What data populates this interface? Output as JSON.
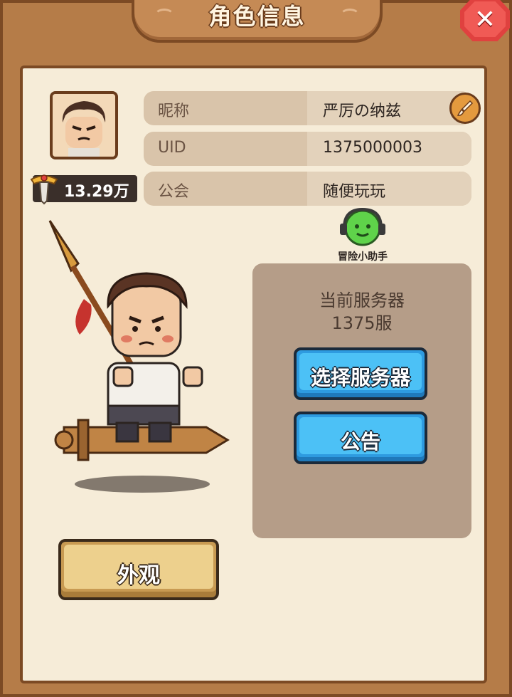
{
  "window": {
    "title": "角色信息",
    "close_icon": "close-x-icon"
  },
  "profile": {
    "power_value": "13.29万",
    "power_icon": "sword-trophy-icon",
    "rows": [
      {
        "label": "昵称",
        "value": "严厉の纳兹"
      },
      {
        "label": "UID",
        "value": "1375000003"
      },
      {
        "label": "公会",
        "value": "随便玩玩"
      }
    ],
    "edit_icon": "brush-edit-icon"
  },
  "assistant": {
    "label": "冒险小助手",
    "icon": "headset-assistant-icon"
  },
  "server": {
    "title": "当前服务器",
    "name": "1375服",
    "select_button": "选择服务器",
    "notice_button": "公告"
  },
  "appearance": {
    "button_label": "外观"
  },
  "colors": {
    "frame": "#b57c48",
    "panel": "#f6ecd8",
    "blue_button": "#4cc1f6",
    "gold_button": "#edd08d",
    "close_button": "#f05a55"
  }
}
